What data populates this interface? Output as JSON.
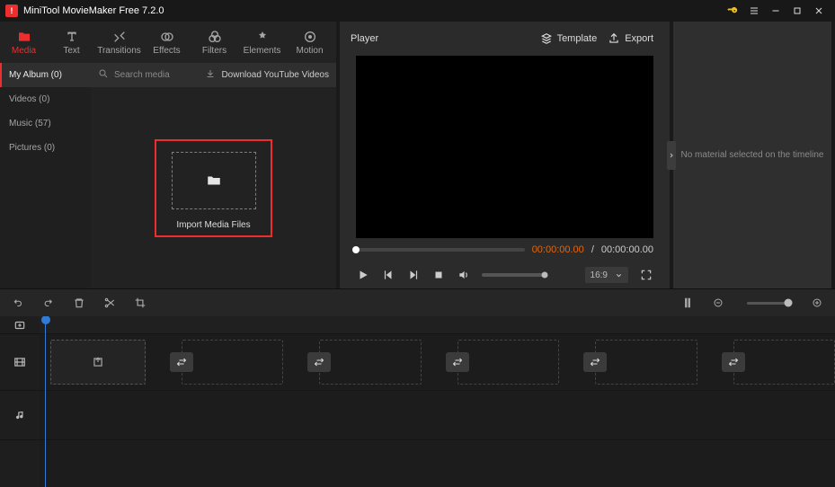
{
  "app": {
    "title": "MiniTool MovieMaker Free 7.2.0"
  },
  "tabs": {
    "media": "Media",
    "text": "Text",
    "transitions": "Transitions",
    "effects": "Effects",
    "filters": "Filters",
    "elements": "Elements",
    "motion": "Motion"
  },
  "categories": {
    "myalbum": "My Album (0)",
    "videos": "Videos (0)",
    "music": "Music (57)",
    "pictures": "Pictures (0)"
  },
  "search": {
    "placeholder": "Search media",
    "download": "Download YouTube Videos"
  },
  "import": {
    "label": "Import Media Files"
  },
  "player": {
    "title": "Player",
    "template": "Template",
    "export": "Export",
    "timeCurrent": "00:00:00.00",
    "timeSep": " / ",
    "timeTotal": "00:00:00.00",
    "ratio": "16:9"
  },
  "inspector": {
    "placeholder": "No material selected on the timeline"
  }
}
